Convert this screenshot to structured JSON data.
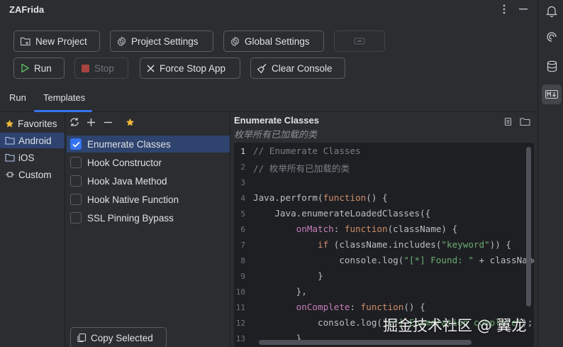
{
  "app": {
    "title": "ZAFrida"
  },
  "toolbar": {
    "new_project": "New Project",
    "project_settings": "Project Settings",
    "global_settings": "Global Settings",
    "run": "Run",
    "stop": "Stop",
    "force_stop": "Force Stop App",
    "clear_console": "Clear Console"
  },
  "tabs": [
    {
      "label": "Run"
    },
    {
      "label": "Templates"
    }
  ],
  "categories": [
    {
      "label": "Favorites"
    },
    {
      "label": "Android"
    },
    {
      "label": "iOS"
    },
    {
      "label": "Custom"
    }
  ],
  "templates": [
    {
      "label": "Enumerate Classes",
      "checked": true
    },
    {
      "label": "Hook Constructor",
      "checked": false
    },
    {
      "label": "Hook Java Method",
      "checked": false
    },
    {
      "label": "Hook Native Function",
      "checked": false
    },
    {
      "label": "SSL Pinning Bypass",
      "checked": false
    }
  ],
  "copy_selected": "Copy Selected",
  "editor": {
    "title": "Enumerate Classes",
    "subtitle": "枚举所有已加载的类",
    "line_numbers": [
      "1",
      "2",
      "3",
      "4",
      "5",
      "6",
      "7",
      "8",
      "9",
      "10",
      "11",
      "12",
      "13"
    ],
    "lines": {
      "l1": "// Enumerate Classes",
      "l2": "// 枚举所有已加载的类",
      "l4a": "Java.perform(",
      "l4b": "function",
      "l4c": "() {",
      "l5": "    Java.enumerateLoadedClasses({",
      "l6a": "onMatch",
      "l6b": ": ",
      "l6c": "function",
      "l6d": "(className) {",
      "l7a": "if",
      "l7b": " (className.includes(",
      "l7c": "\"keyword\"",
      "l7d": ")) {",
      "l8a": "console.log(",
      "l8b": "\"[*] Found: \"",
      "l8c": " + className);",
      "l9": "}",
      "l10": "},",
      "l11a": "onComplete",
      "l11b": ": ",
      "l11c": "function",
      "l11d": "() {",
      "l12a": "console.log(",
      "l12b": "\"[*] Enumeration complete\"",
      "l12c": ");",
      "l13": "}"
    }
  },
  "watermark": "掘金技术社区 @ 翼龙",
  "colors": {
    "accent": "#3574f0",
    "selection": "#2e436e",
    "background": "#2b2d30",
    "editor_bg": "#1e1f22"
  }
}
